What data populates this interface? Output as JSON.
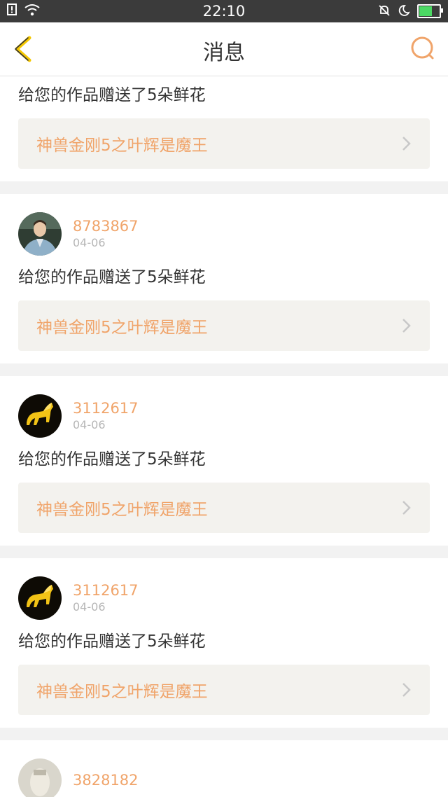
{
  "status_bar": {
    "time": "22:10",
    "icons": [
      "notification-icon",
      "wifi-icon",
      "mute-icon",
      "do-not-disturb-icon",
      "battery-icon"
    ],
    "battery_color": "#4cd964"
  },
  "header": {
    "title": "消息",
    "back_icon": "chevron-left-icon",
    "search_icon": "search-icon",
    "accent_color": "#f0a46a"
  },
  "messages": [
    {
      "message": "给您的作品赠送了5朵鲜花",
      "work_title": "神兽金刚5之叶辉是魔王"
    },
    {
      "username": "8783867",
      "date": "04-06",
      "avatar": "person-avatar",
      "message": "给您的作品赠送了5朵鲜花",
      "work_title": "神兽金刚5之叶辉是魔王"
    },
    {
      "username": "3112617",
      "date": "04-06",
      "avatar": "golden-horse-avatar",
      "message": "给您的作品赠送了5朵鲜花",
      "work_title": "神兽金刚5之叶辉是魔王"
    },
    {
      "username": "3112617",
      "date": "04-06",
      "avatar": "golden-horse-avatar",
      "message": "给您的作品赠送了5朵鲜花",
      "work_title": "神兽金刚5之叶辉是魔王"
    },
    {
      "username": "3828182",
      "avatar": "statue-avatar"
    }
  ]
}
